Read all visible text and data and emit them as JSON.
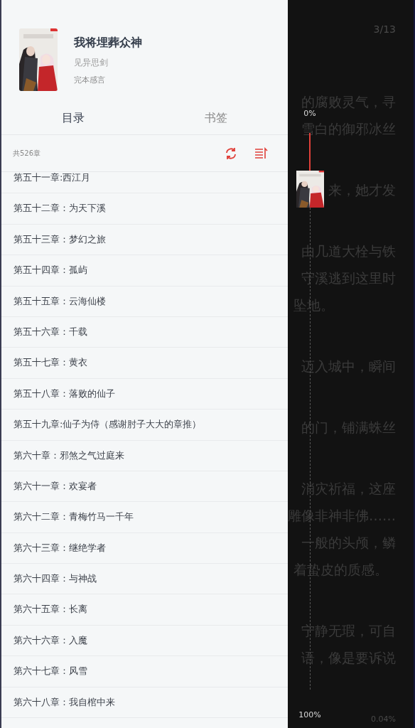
{
  "book": {
    "title": "我将埋葬众神",
    "author": "见异思剑",
    "afterword": "完本感言"
  },
  "tabs": [
    {
      "label": "目录",
      "selected": true
    },
    {
      "label": "书签",
      "selected": false
    }
  ],
  "chapter_count": "共526章",
  "chapters": [
    {
      "title": "第五十一章:西江月"
    },
    {
      "title": "第五十二章：为天下溪"
    },
    {
      "title": "第五十三章：梦幻之旅"
    },
    {
      "title": "第五十四章：孤屿"
    },
    {
      "title": "第五十五章：云海仙楼"
    },
    {
      "title": "第五十六章：千载"
    },
    {
      "title": "第五十七章：黄衣"
    },
    {
      "title": "第五十八章：落败的仙子"
    },
    {
      "title": "第五十九章:仙子为侍（感谢肘子大大的章推）"
    },
    {
      "title": "第六十章：邪煞之气过庭来"
    },
    {
      "title": "第六十一章：欢宴者"
    },
    {
      "title": "第六十二章：青梅竹马一千年"
    },
    {
      "title": "第六十三章：继绝学者"
    },
    {
      "title": "第六十四章：与神战"
    },
    {
      "title": "第六十五章：长离"
    },
    {
      "title": "第六十六章：入魔"
    },
    {
      "title": "第六十七章：风雪"
    },
    {
      "title": "第六十八章：我自棺中来"
    }
  ],
  "reader": {
    "page": "3/13",
    "progress_reading": "0.04%",
    "paragraphs": [
      {
        "lines": [
          {
            "text": "的腐败灵气，寻",
            "kind": "full"
          },
          {
            "text": "雪白的御邪冰丝",
            "kind": "full"
          }
        ]
      },
      {
        "lines": [
          {
            "text": "来，她才发",
            "kind": "full"
          }
        ]
      },
      {
        "lines": [
          {
            "text": "由几道大栓与铁",
            "kind": "full"
          },
          {
            "text": "守溪逃到这里时",
            "kind": "full"
          },
          {
            "text": "坠地。",
            "kind": "last"
          }
        ]
      },
      {
        "lines": [
          {
            "text": "迈入城中，瞬间",
            "kind": "full"
          }
        ]
      },
      {
        "lines": [
          {
            "text": "的门，铺满蛛丝",
            "kind": "full"
          }
        ]
      },
      {
        "lines": [
          {
            "text": "消灾祈福，这座",
            "kind": "full"
          },
          {
            "text": "雕像非神非佛……",
            "kind": "full"
          },
          {
            "text": "一般的头颅，鳞",
            "kind": "full"
          },
          {
            "text": "着蛰皮的质感。",
            "kind": "last"
          }
        ]
      },
      {
        "lines": [
          {
            "text": "宁静无瑕，可自",
            "kind": "full"
          },
          {
            "text": "语，像是要诉说",
            "kind": "full"
          }
        ]
      }
    ]
  },
  "chapter_slider": {
    "top_label": "0%",
    "bottom_label": "100%"
  }
}
